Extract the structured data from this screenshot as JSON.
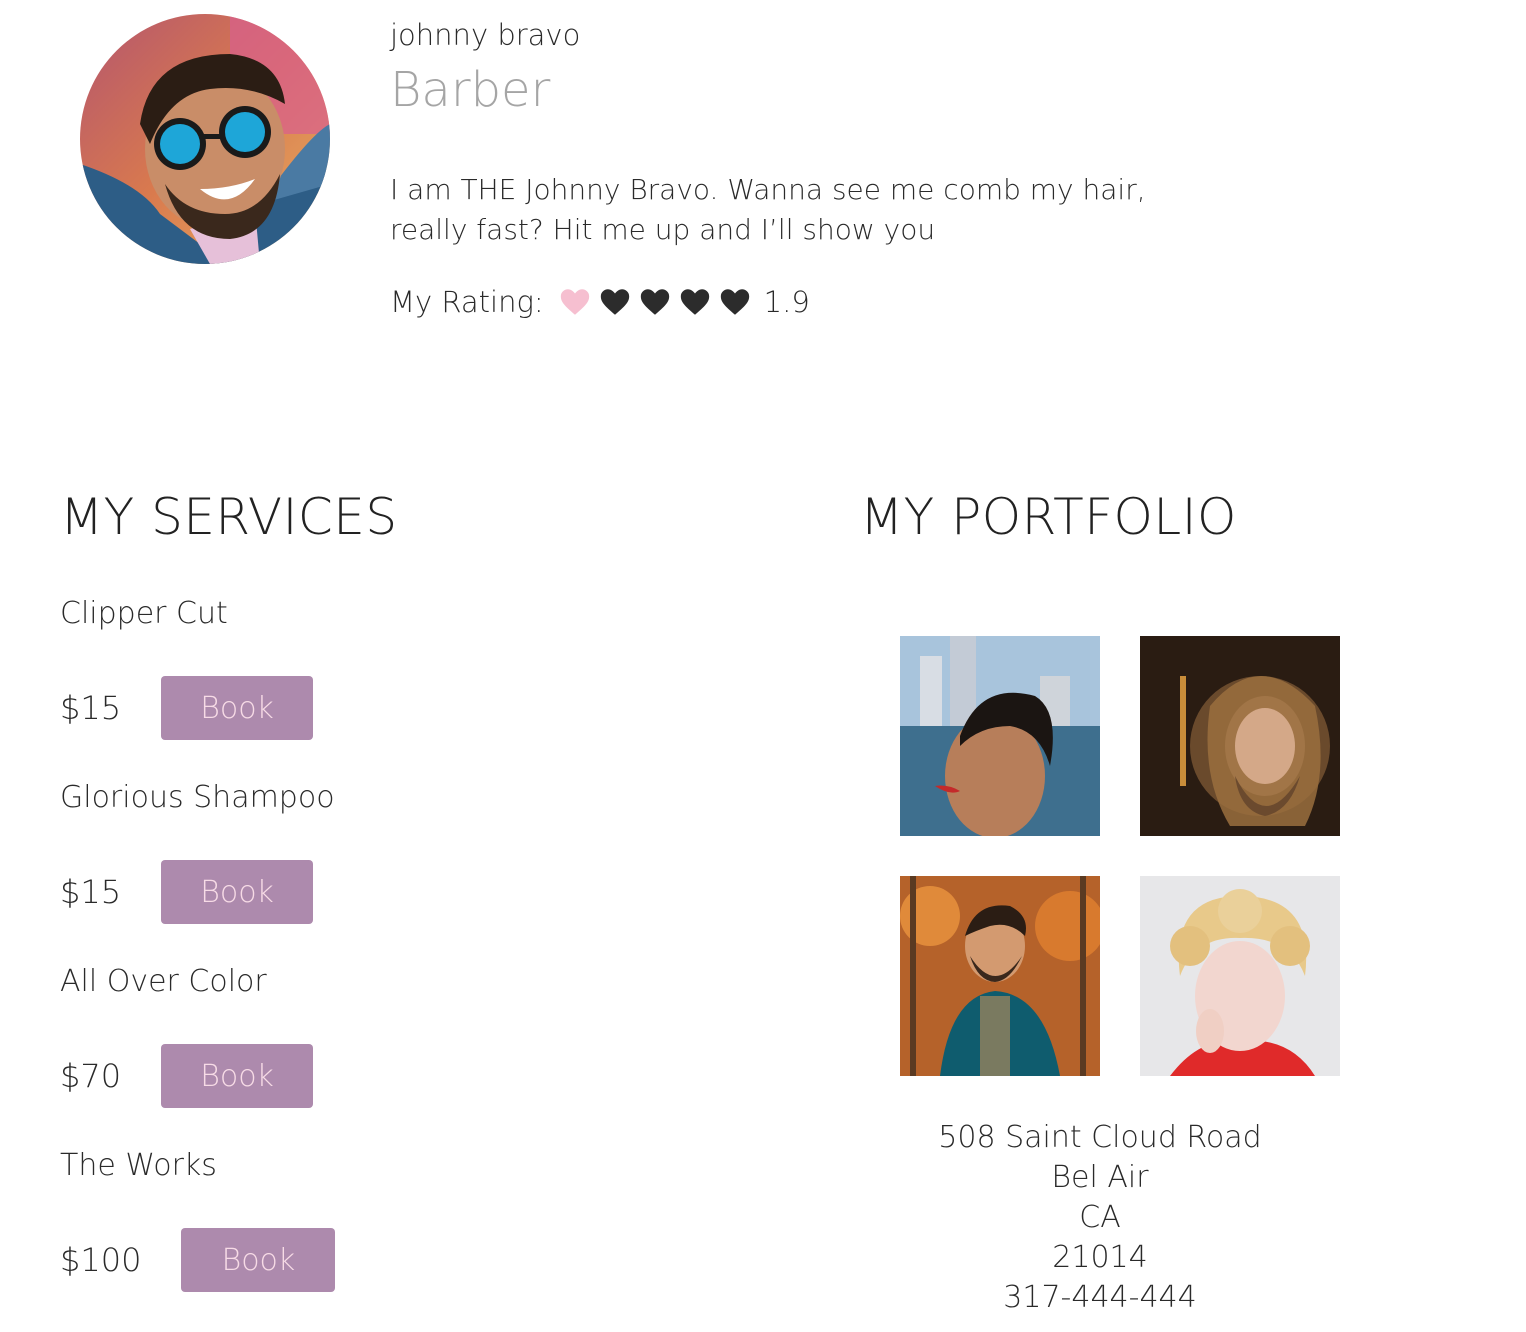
{
  "profile": {
    "name": "johnny bravo",
    "role": "Barber",
    "bio": "I am THE Johnny Bravo. Wanna see me comb my hair, really fast? Hit me up and I’ll show you",
    "rating_label": "My Rating:",
    "rating_value": "1.9",
    "rating_hearts_filled": 1,
    "rating_hearts_total": 5,
    "avatar_icon": "avatar-photo"
  },
  "services": {
    "title": "MY SERVICES",
    "items": [
      {
        "name": "Clipper Cut",
        "price": "$15",
        "book_label": "Book"
      },
      {
        "name": "Glorious Shampoo",
        "price": "$15",
        "book_label": "Book"
      },
      {
        "name": "All Over Color",
        "price": "$70",
        "book_label": "Book"
      },
      {
        "name": "The Works",
        "price": "$100",
        "book_label": "Book"
      }
    ]
  },
  "portfolio": {
    "title": "MY PORTFOLIO",
    "images": [
      {
        "name": "portfolio-photo"
      },
      {
        "name": "portfolio-photo"
      },
      {
        "name": "portfolio-photo"
      },
      {
        "name": "portfolio-photo"
      }
    ]
  },
  "address": {
    "street": "508 Saint Cloud Road",
    "city": "Bel Air",
    "state": "CA",
    "zip": "21014",
    "phone": "317-444-444"
  },
  "colors": {
    "book_button_bg": "#ad8aad",
    "book_button_text": "#f7dbe6",
    "heart_active": "#f6bfd0",
    "heart_inactive": "#2c2c2c",
    "role_text": "#a5a5a5"
  }
}
